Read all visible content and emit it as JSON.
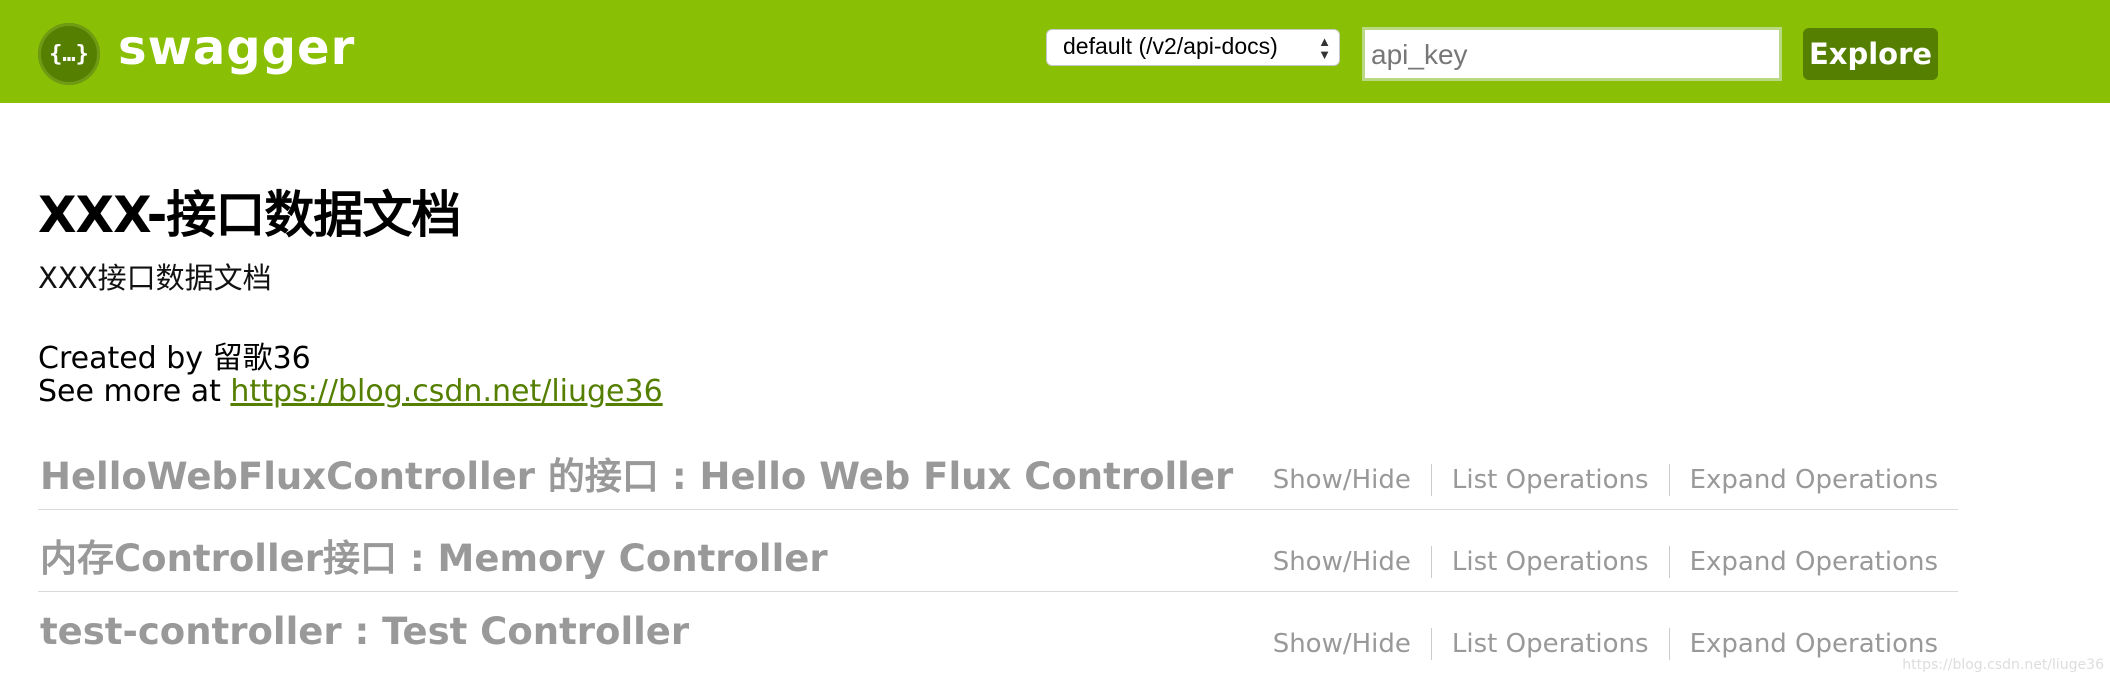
{
  "header": {
    "logo_glyph": "{…}",
    "logo_text": "swagger",
    "spec_select": {
      "selected": "default (/v2/api-docs)"
    },
    "api_key_input": {
      "placeholder": "api_key",
      "value": ""
    },
    "explore_label": "Explore",
    "colors": {
      "bar": "#89bf04",
      "button": "#547f00"
    }
  },
  "info": {
    "title": "XXX-接口数据文档",
    "description": "XXX接口数据文档",
    "created_by": "Created by 留歌36",
    "see_more_prefix": "See more at ",
    "see_more_link": "https://blog.csdn.net/liuge36"
  },
  "resources": [
    {
      "title": "HelloWebFluxController 的接口 : Hello Web Flux Controller",
      "ops": [
        "Show/Hide",
        "List Operations",
        "Expand Operations"
      ]
    },
    {
      "title": "内存Controller接口 : Memory Controller",
      "ops": [
        "Show/Hide",
        "List Operations",
        "Expand Operations"
      ]
    },
    {
      "title": "test-controller : Test Controller",
      "ops": [
        "Show/Hide",
        "List Operations",
        "Expand Operations"
      ]
    }
  ],
  "watermark": "https://blog.csdn.net/liuge36"
}
